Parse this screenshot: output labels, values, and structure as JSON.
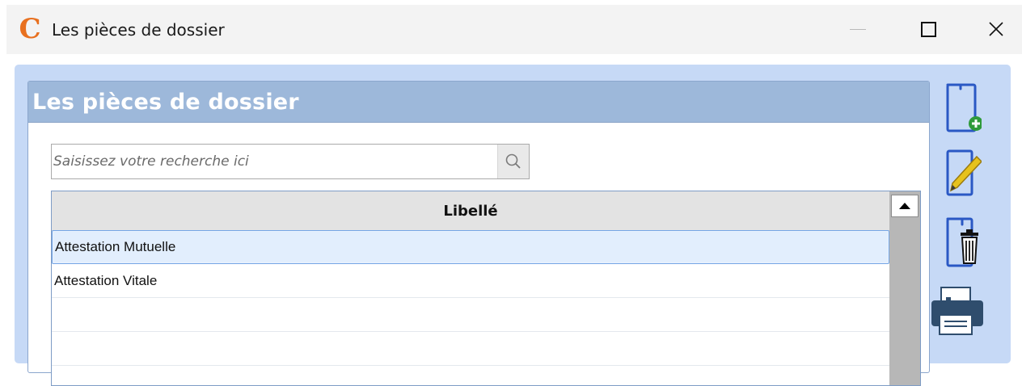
{
  "window": {
    "title": "Les pièces de dossier",
    "app_icon": "c-logo-icon",
    "controls": [
      "minimize-icon",
      "maximize-icon",
      "close-icon"
    ],
    "close_glyph": "✕"
  },
  "panel": {
    "title": "Les pièces de dossier"
  },
  "search": {
    "placeholder": "Saisissez votre recherche ici",
    "value": "",
    "icon": "search-icon"
  },
  "table": {
    "columns": [
      "Libellé"
    ],
    "rows": [
      {
        "libelle": "Attestation Mutuelle",
        "selected": true
      },
      {
        "libelle": "Attestation Vitale",
        "selected": false
      },
      {
        "libelle": "",
        "selected": false
      }
    ]
  },
  "toolbar": {
    "items": [
      {
        "name": "add-document-icon"
      },
      {
        "name": "edit-document-icon"
      },
      {
        "name": "delete-document-icon"
      },
      {
        "name": "print-icon"
      }
    ]
  },
  "colors": {
    "accent": "#e8701f",
    "panel_header": "#9db8da",
    "background": "#c6d9f6",
    "add_green": "#2f9a3a",
    "pencil_yellow": "#e6c21c",
    "icon_blue": "#2a58c4"
  }
}
